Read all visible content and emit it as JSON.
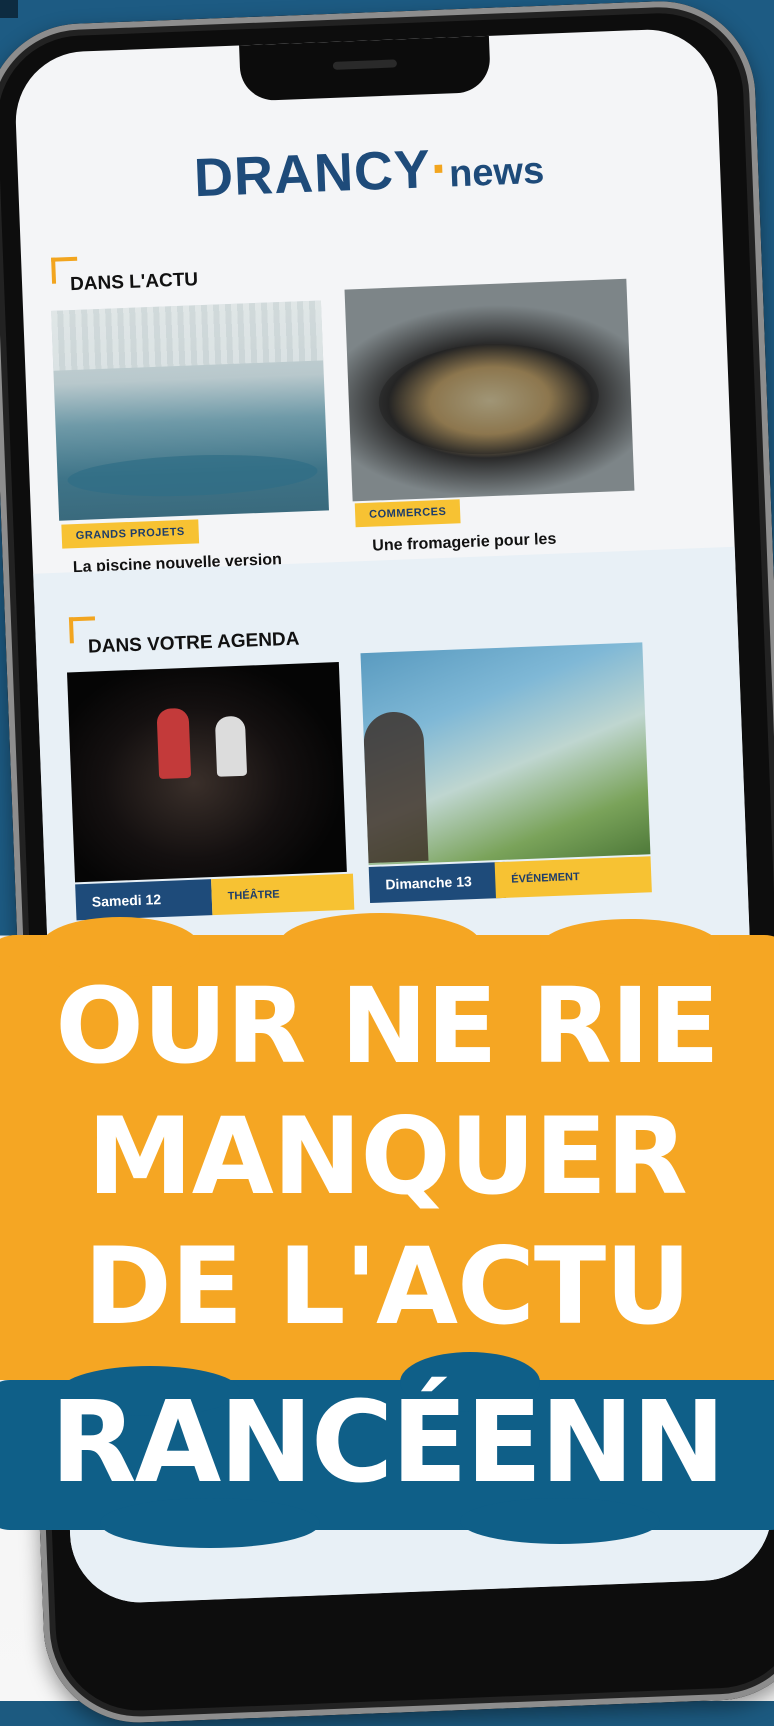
{
  "brand": {
    "name": "DRANCY",
    "suffix": "news"
  },
  "actu": {
    "heading": "DANS L'ACTU",
    "cards": [
      {
        "tag": "GRANDS PROJETS",
        "title": "La piscine nouvelle version"
      },
      {
        "tag": "COMMERCES",
        "title": "Une fromagerie pour les gourmets"
      }
    ]
  },
  "agenda": {
    "heading": "DANS VOTRE AGENDA",
    "cards": [
      {
        "date": "Samedi 12",
        "category": "THÉÂTRE"
      },
      {
        "date": "Dimanche 13",
        "category": "ÉVÉNEMENT"
      }
    ]
  },
  "banner": {
    "line1": "OUR NE RIE",
    "line2": "MANQUER",
    "line3": "DE L'ACTU",
    "line4": "RANCÉENN"
  },
  "colors": {
    "navy": "#1e4b7a",
    "orange": "#f5a623",
    "yellow": "#f7c233",
    "blue": "#0f5f88"
  }
}
